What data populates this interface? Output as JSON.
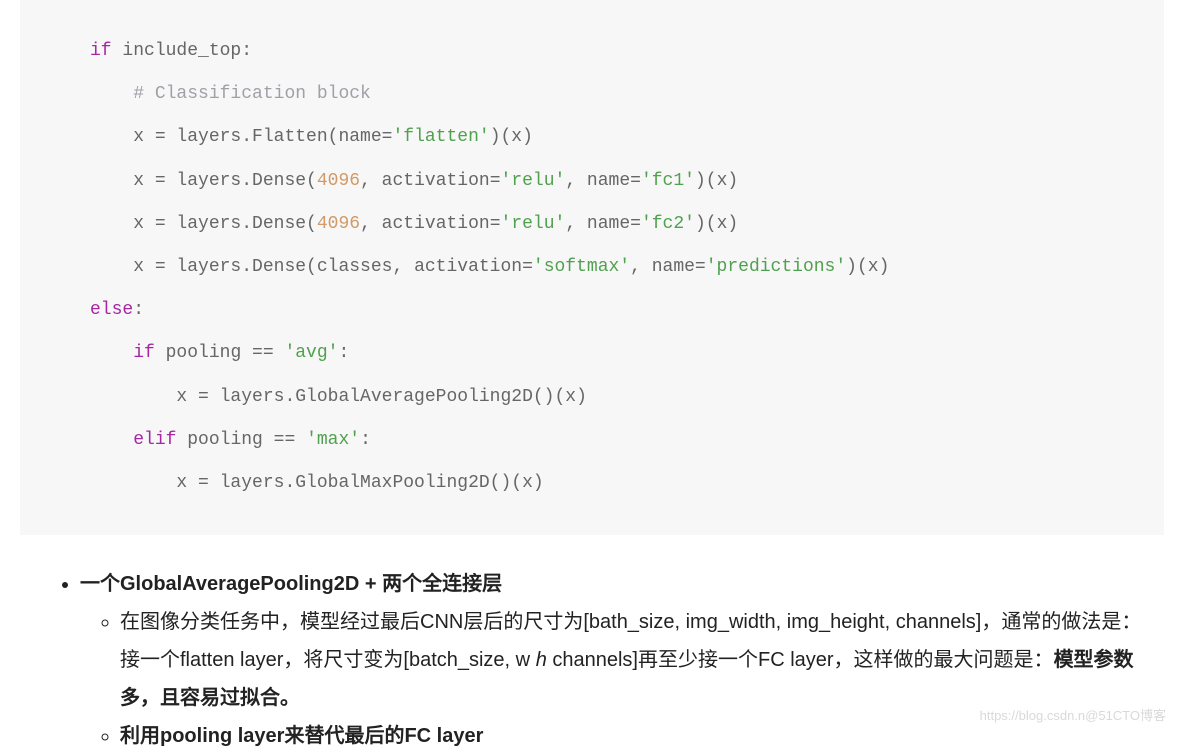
{
  "code": {
    "l1": {
      "kw1": "if",
      "rest": " include_top:"
    },
    "l2": {
      "comment": "# Classification block"
    },
    "l3": {
      "pre": "x = layers.Flatten(name=",
      "s1": "'flatten'",
      "post": ")(x)"
    },
    "l4": {
      "pre": "x = layers.Dense(",
      "n1": "4096",
      "mid1": ", activation=",
      "s1": "'relu'",
      "mid2": ", name=",
      "s2": "'fc1'",
      "post": ")(x)"
    },
    "l5": {
      "pre": "x = layers.Dense(",
      "n1": "4096",
      "mid1": ", activation=",
      "s1": "'relu'",
      "mid2": ", name=",
      "s2": "'fc2'",
      "post": ")(x)"
    },
    "l6": {
      "pre": "x = layers.Dense(classes, activation=",
      "s1": "'softmax'",
      "mid2": ", name=",
      "s2": "'predictions'",
      "post": ")(x)"
    },
    "l7": {
      "kw1": "else",
      "rest": ":"
    },
    "l8": {
      "kw1": "if",
      "mid": " pooling == ",
      "s1": "'avg'",
      "post": ":"
    },
    "l9": "x = layers.GlobalAveragePooling2D()(x)",
    "l10": {
      "kw1": "elif",
      "mid": " pooling == ",
      "s1": "'max'",
      "post": ":"
    },
    "l11": "x = layers.GlobalMaxPooling2D()(x)"
  },
  "article": {
    "bulletTitle": "一个GlobalAveragePooling2D + 两个全连接层",
    "sub1": {
      "t1": "在图像分类任务中，模型经过最后CNN层后的尺寸为[bath_size, img_width, img_height, channels]，通常的做法是：接一个flatten layer，将尺寸变为[batch_size, w ",
      "it": "h",
      "t2": " channels]再至少接一个FC layer，这样做的最大问题是：",
      "boldTail": "模型参数多，且容易过拟合。"
    },
    "sub2": "利用pooling layer来替代最后的FC layer"
  },
  "watermark": "https://blog.csdn.n@51CTO博客"
}
